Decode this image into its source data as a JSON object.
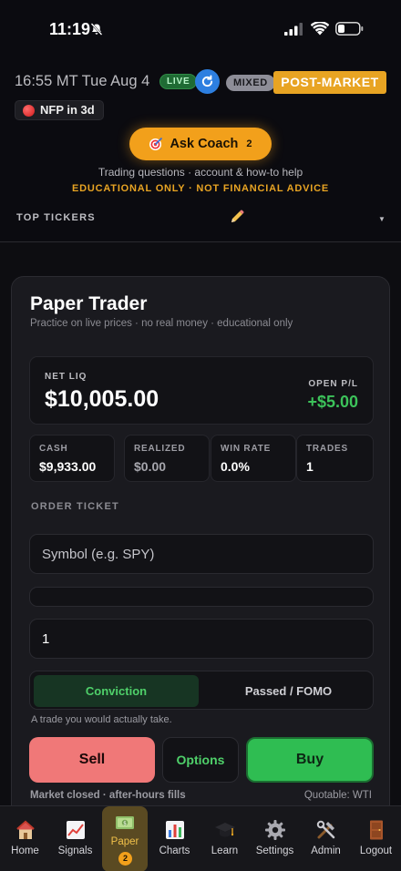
{
  "status_bar": {
    "time": "11:19"
  },
  "header": {
    "date_line": "16:55 MT Tue Aug 4",
    "live_badge": "LIVE",
    "mixed_badge": "MIXED",
    "session_badge": "POST-MARKET",
    "event_badge": "NFP in 3d",
    "coach_button": {
      "label": "Ask Coach",
      "count": "2"
    },
    "coach_subtitle": "Trading questions · account & how-to help",
    "coach_disclaimer": "EDUCATIONAL ONLY · NOT FINANCIAL ADVICE",
    "top_tickers_label": "TOP TICKERS"
  },
  "paper_trader": {
    "title": "Paper Trader",
    "subtitle": "Practice on live prices · no real money · educational only",
    "net_liq": {
      "label": "NET LIQ",
      "value": "$10,005.00"
    },
    "open_pl": {
      "label": "OPEN P/L",
      "value": "+$5.00"
    },
    "stats": [
      {
        "label": "CASH",
        "value": "$9,933.00"
      },
      {
        "label": "REALIZED",
        "value": "$0.00"
      },
      {
        "label": "WIN RATE",
        "value": "0.0%"
      },
      {
        "label": "TRADES",
        "value": "1"
      }
    ],
    "order_ticket_label": "ORDER TICKET",
    "symbol_placeholder": "Symbol (e.g. SPY)",
    "quantity_value": "1",
    "segment": {
      "on": "Conviction",
      "off": "Passed / FOMO"
    },
    "segment_hint": "A trade you would actually take.",
    "sell_label": "Sell",
    "options_label": "Options",
    "buy_label": "Buy",
    "market_status": "Market closed · after-hours fills",
    "quotable": "Quotable: WTI"
  },
  "bottom_nav": {
    "items": [
      {
        "label": "Home",
        "icon": "house-icon"
      },
      {
        "label": "Signals",
        "icon": "chart-up-icon"
      },
      {
        "label": "Paper",
        "icon": "money-icon",
        "badge": "2"
      },
      {
        "label": "Charts",
        "icon": "bar-chart-icon"
      },
      {
        "label": "Learn",
        "icon": "graduation-cap-icon"
      },
      {
        "label": "Settings",
        "icon": "gear-icon"
      },
      {
        "label": "Admin",
        "icon": "tools-icon"
      },
      {
        "label": "Logout",
        "icon": "door-icon"
      }
    ]
  },
  "colors": {
    "accent": "#f2a01b",
    "buy": "#2fbd52",
    "sell": "#f07878",
    "positive": "#3cc25a"
  }
}
